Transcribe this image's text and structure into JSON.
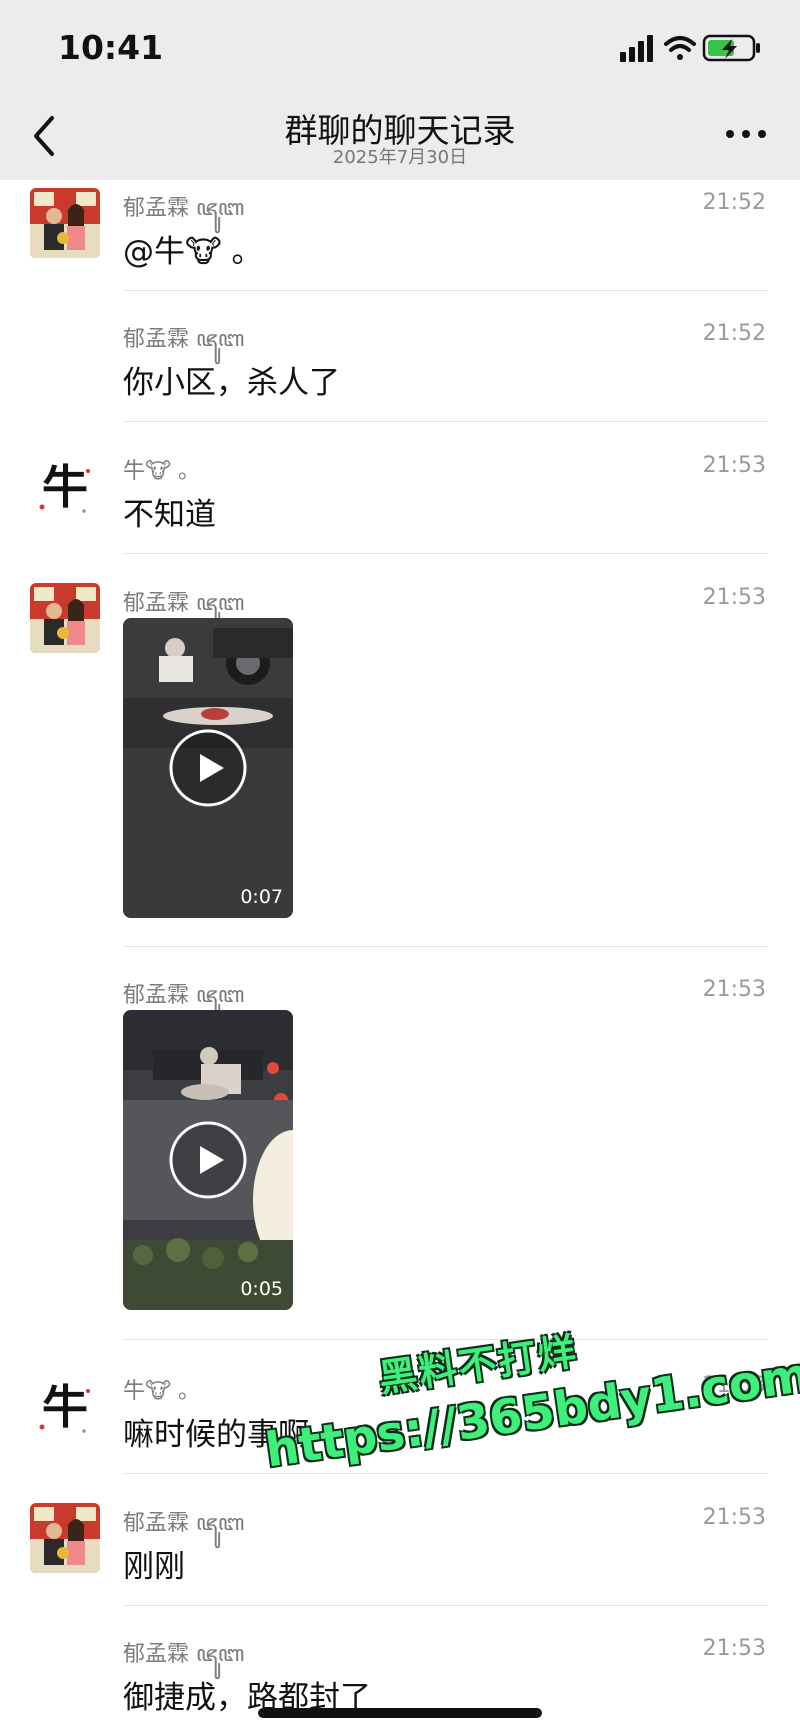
{
  "status": {
    "time": "10:41"
  },
  "nav": {
    "title": "群聊的聊天记录",
    "date": "2025年7月30日"
  },
  "messages": [
    {
      "sender": "郁孟霖 ꦗꦸꦧ",
      "time": "21:52",
      "text": "@牛🐮 。"
    },
    {
      "sender": "郁孟霖 ꦗꦸꦧ",
      "time": "21:52",
      "text": "你小区，杀人了"
    },
    {
      "sender": "牛🐮 。",
      "time": "21:53",
      "text": "不知道"
    },
    {
      "sender": "郁孟霖 ꦗꦸꦧ",
      "time": "21:53",
      "duration": "0:07"
    },
    {
      "sender": "郁孟霖 ꦗꦸꦧ",
      "time": "21:53",
      "duration": "0:05"
    },
    {
      "sender": "牛🐮 。",
      "time": "21:53",
      "text": "嘛时候的事啊"
    },
    {
      "sender": "郁孟霖 ꦗꦸꦧ",
      "time": "21:53",
      "text": "刚刚"
    },
    {
      "sender": "郁孟霖 ꦗꦸꦧ",
      "time": "21:53",
      "text": "御捷成，路都封了"
    }
  ],
  "avatar_niu": {
    "glyph": "牛"
  },
  "watermark": {
    "line1": "黑料不打烊",
    "line2": "https://365bdy1.com"
  },
  "colors": {
    "watermark": "#3ef07b",
    "navbar": "#ececec"
  }
}
